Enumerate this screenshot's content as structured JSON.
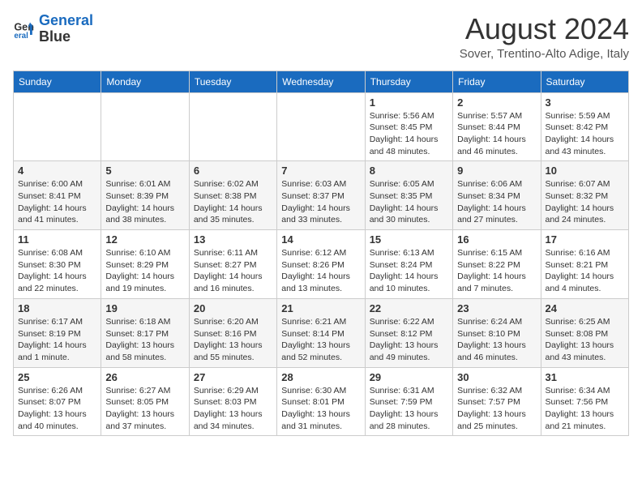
{
  "header": {
    "logo_line1": "General",
    "logo_line2": "Blue",
    "month_year": "August 2024",
    "location": "Sover, Trentino-Alto Adige, Italy"
  },
  "weekdays": [
    "Sunday",
    "Monday",
    "Tuesday",
    "Wednesday",
    "Thursday",
    "Friday",
    "Saturday"
  ],
  "weeks": [
    [
      {
        "day": "",
        "info": ""
      },
      {
        "day": "",
        "info": ""
      },
      {
        "day": "",
        "info": ""
      },
      {
        "day": "",
        "info": ""
      },
      {
        "day": "1",
        "info": "Sunrise: 5:56 AM\nSunset: 8:45 PM\nDaylight: 14 hours\nand 48 minutes."
      },
      {
        "day": "2",
        "info": "Sunrise: 5:57 AM\nSunset: 8:44 PM\nDaylight: 14 hours\nand 46 minutes."
      },
      {
        "day": "3",
        "info": "Sunrise: 5:59 AM\nSunset: 8:42 PM\nDaylight: 14 hours\nand 43 minutes."
      }
    ],
    [
      {
        "day": "4",
        "info": "Sunrise: 6:00 AM\nSunset: 8:41 PM\nDaylight: 14 hours\nand 41 minutes."
      },
      {
        "day": "5",
        "info": "Sunrise: 6:01 AM\nSunset: 8:39 PM\nDaylight: 14 hours\nand 38 minutes."
      },
      {
        "day": "6",
        "info": "Sunrise: 6:02 AM\nSunset: 8:38 PM\nDaylight: 14 hours\nand 35 minutes."
      },
      {
        "day": "7",
        "info": "Sunrise: 6:03 AM\nSunset: 8:37 PM\nDaylight: 14 hours\nand 33 minutes."
      },
      {
        "day": "8",
        "info": "Sunrise: 6:05 AM\nSunset: 8:35 PM\nDaylight: 14 hours\nand 30 minutes."
      },
      {
        "day": "9",
        "info": "Sunrise: 6:06 AM\nSunset: 8:34 PM\nDaylight: 14 hours\nand 27 minutes."
      },
      {
        "day": "10",
        "info": "Sunrise: 6:07 AM\nSunset: 8:32 PM\nDaylight: 14 hours\nand 24 minutes."
      }
    ],
    [
      {
        "day": "11",
        "info": "Sunrise: 6:08 AM\nSunset: 8:30 PM\nDaylight: 14 hours\nand 22 minutes."
      },
      {
        "day": "12",
        "info": "Sunrise: 6:10 AM\nSunset: 8:29 PM\nDaylight: 14 hours\nand 19 minutes."
      },
      {
        "day": "13",
        "info": "Sunrise: 6:11 AM\nSunset: 8:27 PM\nDaylight: 14 hours\nand 16 minutes."
      },
      {
        "day": "14",
        "info": "Sunrise: 6:12 AM\nSunset: 8:26 PM\nDaylight: 14 hours\nand 13 minutes."
      },
      {
        "day": "15",
        "info": "Sunrise: 6:13 AM\nSunset: 8:24 PM\nDaylight: 14 hours\nand 10 minutes."
      },
      {
        "day": "16",
        "info": "Sunrise: 6:15 AM\nSunset: 8:22 PM\nDaylight: 14 hours\nand 7 minutes."
      },
      {
        "day": "17",
        "info": "Sunrise: 6:16 AM\nSunset: 8:21 PM\nDaylight: 14 hours\nand 4 minutes."
      }
    ],
    [
      {
        "day": "18",
        "info": "Sunrise: 6:17 AM\nSunset: 8:19 PM\nDaylight: 14 hours\nand 1 minute."
      },
      {
        "day": "19",
        "info": "Sunrise: 6:18 AM\nSunset: 8:17 PM\nDaylight: 13 hours\nand 58 minutes."
      },
      {
        "day": "20",
        "info": "Sunrise: 6:20 AM\nSunset: 8:16 PM\nDaylight: 13 hours\nand 55 minutes."
      },
      {
        "day": "21",
        "info": "Sunrise: 6:21 AM\nSunset: 8:14 PM\nDaylight: 13 hours\nand 52 minutes."
      },
      {
        "day": "22",
        "info": "Sunrise: 6:22 AM\nSunset: 8:12 PM\nDaylight: 13 hours\nand 49 minutes."
      },
      {
        "day": "23",
        "info": "Sunrise: 6:24 AM\nSunset: 8:10 PM\nDaylight: 13 hours\nand 46 minutes."
      },
      {
        "day": "24",
        "info": "Sunrise: 6:25 AM\nSunset: 8:08 PM\nDaylight: 13 hours\nand 43 minutes."
      }
    ],
    [
      {
        "day": "25",
        "info": "Sunrise: 6:26 AM\nSunset: 8:07 PM\nDaylight: 13 hours\nand 40 minutes."
      },
      {
        "day": "26",
        "info": "Sunrise: 6:27 AM\nSunset: 8:05 PM\nDaylight: 13 hours\nand 37 minutes."
      },
      {
        "day": "27",
        "info": "Sunrise: 6:29 AM\nSunset: 8:03 PM\nDaylight: 13 hours\nand 34 minutes."
      },
      {
        "day": "28",
        "info": "Sunrise: 6:30 AM\nSunset: 8:01 PM\nDaylight: 13 hours\nand 31 minutes."
      },
      {
        "day": "29",
        "info": "Sunrise: 6:31 AM\nSunset: 7:59 PM\nDaylight: 13 hours\nand 28 minutes."
      },
      {
        "day": "30",
        "info": "Sunrise: 6:32 AM\nSunset: 7:57 PM\nDaylight: 13 hours\nand 25 minutes."
      },
      {
        "day": "31",
        "info": "Sunrise: 6:34 AM\nSunset: 7:56 PM\nDaylight: 13 hours\nand 21 minutes."
      }
    ]
  ]
}
